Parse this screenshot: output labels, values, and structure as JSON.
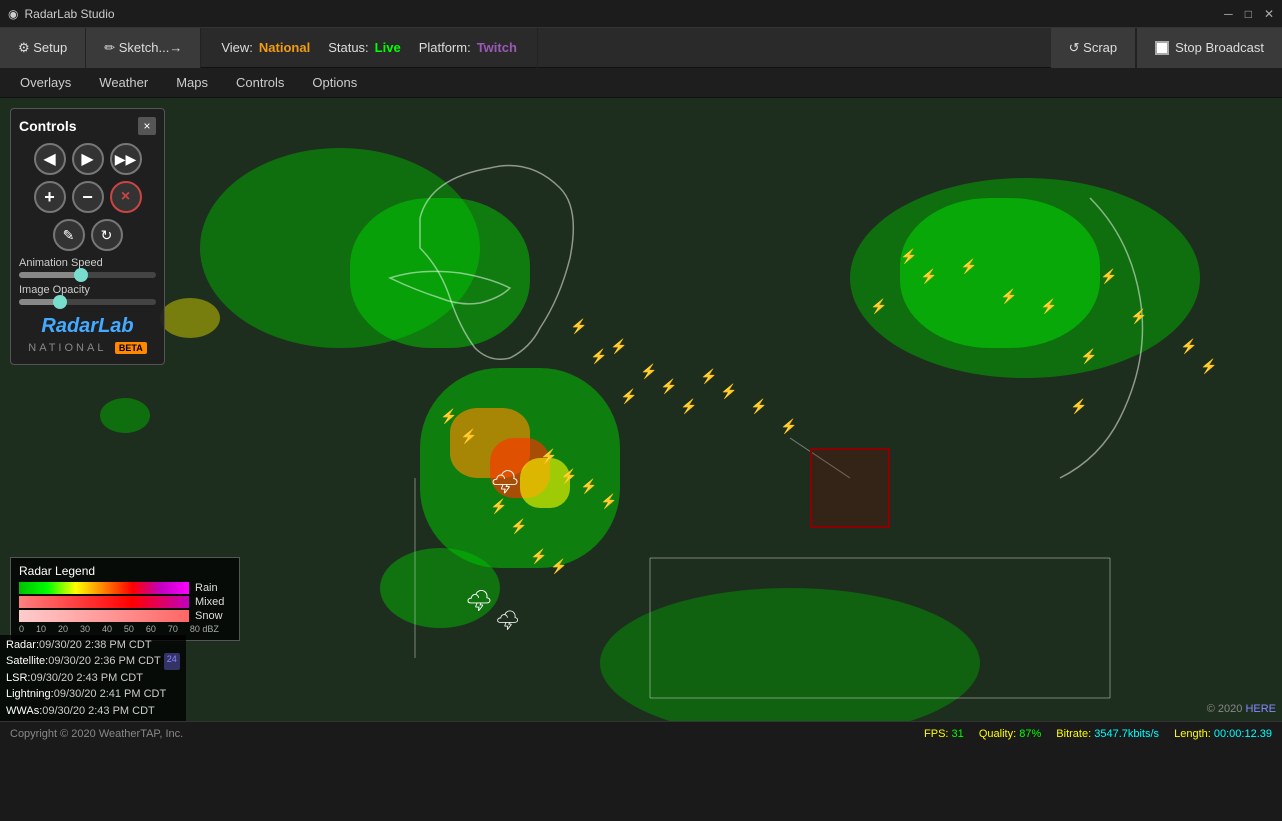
{
  "titlebar": {
    "title": "RadarLab Studio",
    "icon": "◉",
    "minimize": "─",
    "maximize": "□",
    "close": "✕"
  },
  "toolbar": {
    "setup_label": "⚙ Setup",
    "sketch_label": "✏ Sketch...→",
    "view_label": "View:",
    "view_value": "National",
    "status_label": "Status:",
    "status_value": "Live",
    "platform_label": "Platform:",
    "platform_value": "Twitch",
    "scrap_label": "↺ Scrap",
    "stop_label": "Stop Broadcast"
  },
  "menubar": {
    "items": [
      {
        "id": "overlays",
        "label": "Overlays"
      },
      {
        "id": "weather",
        "label": "Weather"
      },
      {
        "id": "maps",
        "label": "Maps"
      },
      {
        "id": "controls",
        "label": "Controls"
      },
      {
        "id": "options",
        "label": "Options"
      }
    ]
  },
  "controls_panel": {
    "title": "Controls",
    "prev_label": "◀",
    "play_label": "▶",
    "next_label": "▶",
    "zoom_in_label": "+",
    "zoom_out_label": "−",
    "close_label": "×",
    "edit_label": "✎",
    "refresh_label": "↻",
    "animation_speed_label": "Animation Speed",
    "animation_speed_pct": 45,
    "image_opacity_label": "Image Opacity",
    "image_opacity_pct": 30,
    "logo_main": "RadarLab",
    "logo_sub": "NATIONAL",
    "logo_beta": "BETA"
  },
  "radar_legend": {
    "title": "Radar Legend",
    "rows": [
      {
        "label": "Rain",
        "type": "rain"
      },
      {
        "label": "Mixed",
        "type": "mixed"
      },
      {
        "label": "Snow",
        "type": "snow"
      }
    ],
    "scale": [
      "0",
      "10",
      "20",
      "30",
      "40",
      "50",
      "60",
      "70",
      "80 dBZ"
    ]
  },
  "timestamps": [
    {
      "label": "Radar:",
      "value": "09/30/20 2:38 PM CDT",
      "badge": ""
    },
    {
      "label": "Satellite:",
      "value": "09/30/20 2:36 PM CDT",
      "badge": "24"
    },
    {
      "label": "LSR:",
      "value": "09/30/20 2:43 PM CDT",
      "badge": ""
    },
    {
      "label": "Lightning:",
      "value": "09/30/20 2:41 PM CDT",
      "badge": ""
    },
    {
      "label": "WWAs:",
      "value": "09/30/20 2:43 PM CDT",
      "badge": ""
    }
  ],
  "statusbar": {
    "copyright": "Copyright © 2020 WeatherTAP, Inc.",
    "fps_label": "FPS:",
    "fps_value": "31",
    "quality_label": "Quality:",
    "quality_value": "87%",
    "bitrate_label": "Bitrate:",
    "bitrate_value": "3547.7kbits/s",
    "length_label": "Length:",
    "length_value": "00:00:12.39"
  },
  "map_copyright": {
    "text": "© 2020",
    "link_text": "HERE"
  },
  "colors": {
    "live_green": "#00ff00",
    "platform_purple": "#9b59b6",
    "view_orange": "#f39c12",
    "accent_blue": "#4af"
  }
}
